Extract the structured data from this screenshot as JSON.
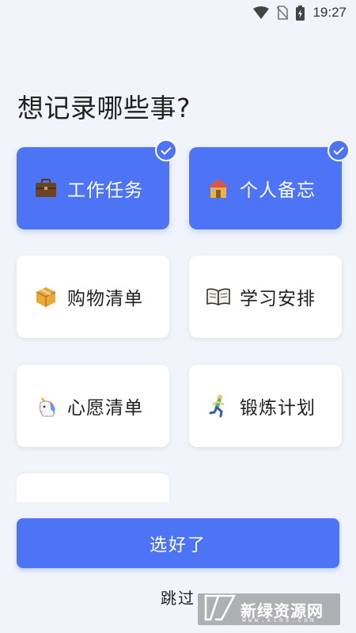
{
  "status_bar": {
    "time": "19:27",
    "icons": [
      "wifi-icon",
      "no-sim-icon",
      "battery-charging-icon"
    ]
  },
  "title": "想记录哪些事?",
  "categories": [
    {
      "label": "工作任务",
      "icon": "briefcase-icon",
      "selected": true
    },
    {
      "label": "个人备忘",
      "icon": "house-icon",
      "selected": true
    },
    {
      "label": "购物清单",
      "icon": "package-icon",
      "selected": false
    },
    {
      "label": "学习安排",
      "icon": "open-book-icon",
      "selected": false
    },
    {
      "label": "心愿清单",
      "icon": "unicorn-icon",
      "selected": false
    },
    {
      "label": "锻炼计划",
      "icon": "runner-icon",
      "selected": false
    }
  ],
  "confirm_button": "选好了",
  "skip_link": "跳过",
  "watermark": {
    "text": "新绿资源网",
    "sub": "www.xlhs.com"
  },
  "colors": {
    "accent": "#4D74F5",
    "background": "#F1F4FB",
    "card": "#FFFFFF"
  }
}
